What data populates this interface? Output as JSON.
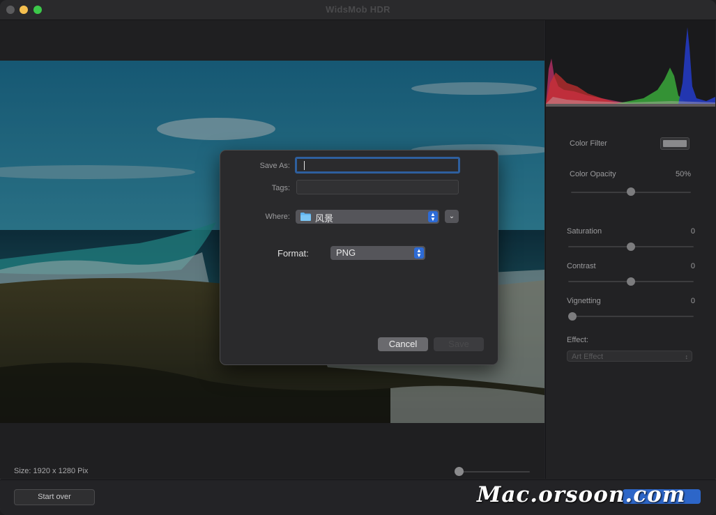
{
  "window": {
    "title": "WidsMob HDR"
  },
  "canvas": {
    "size_label": "Size: 1920 x 1280 Pix",
    "zoom_level": 0
  },
  "bottom_bar": {
    "start_over_label": "Start over",
    "watermark": "Mac.orsoon.com"
  },
  "panel": {
    "color_filter": {
      "label": "Color Filter",
      "swatch_color": "#8a8a8c"
    },
    "color_opacity": {
      "label": "Color Opacity",
      "value": "50%",
      "level": 0.5
    },
    "saturation": {
      "label": "Saturation",
      "value": "0",
      "level": 0.5
    },
    "contrast": {
      "label": "Contrast",
      "value": "0",
      "level": 0.5
    },
    "vignetting": {
      "label": "Vignetting",
      "value": "0",
      "level": 0
    },
    "effect": {
      "label": "Effect:",
      "selected": "Art Effect"
    }
  },
  "dialog": {
    "save_as_label": "Save As:",
    "save_as_value": "",
    "tags_label": "Tags:",
    "tags_value": "",
    "where_label": "Where:",
    "where_value": "风景",
    "format_label": "Format:",
    "format_value": "PNG",
    "cancel_label": "Cancel",
    "save_label": "Save"
  },
  "colors": {
    "accent": "#2d6bd6",
    "traffic_close": "#5b5b5d",
    "traffic_min": "#f4bf4f",
    "traffic_max": "#3cc84a"
  },
  "icons": {
    "folder": "folder-icon",
    "stepper": "chevron-updown-icon",
    "expand": "chevron-down-icon"
  }
}
